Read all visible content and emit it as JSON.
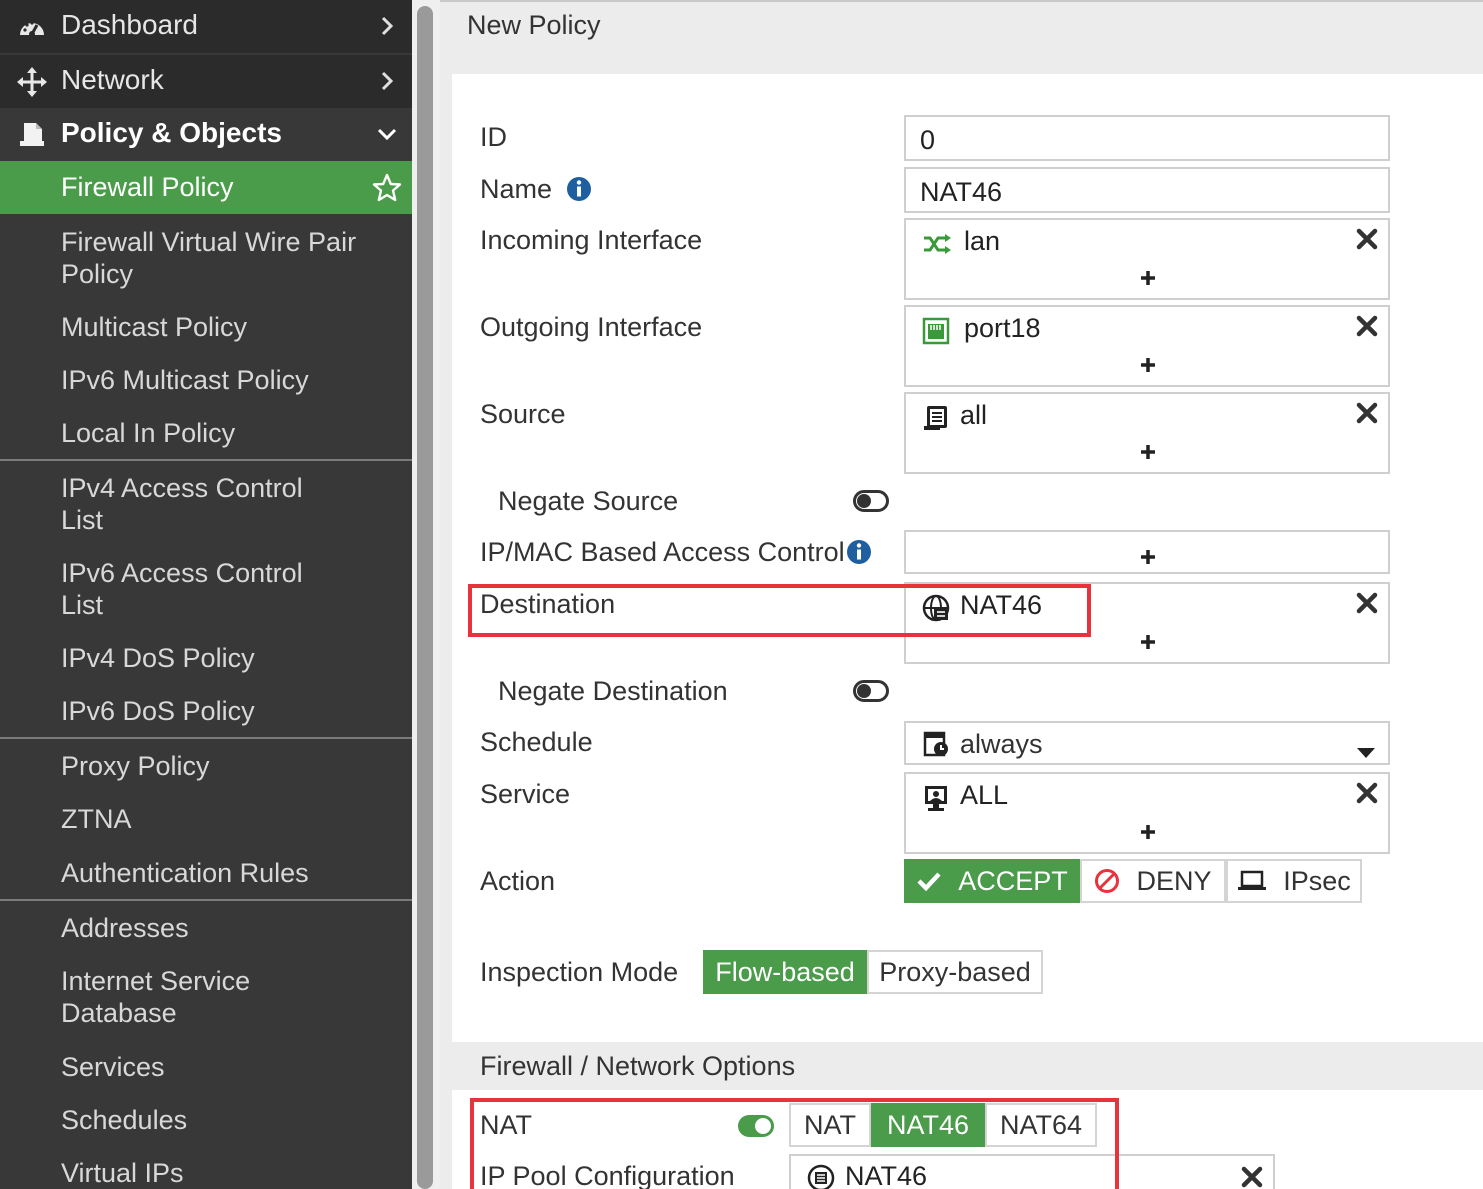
{
  "sidebar": {
    "top_items": [
      {
        "label": "Dashboard",
        "icon": "dashboard-icon"
      },
      {
        "label": "Network",
        "icon": "move-arrows-icon"
      },
      {
        "label": "Policy & Objects",
        "icon": "policy-document-icon"
      }
    ],
    "sub_items": [
      {
        "label": "Firewall Policy",
        "active": true
      },
      {
        "label": "Firewall Virtual Wire Pair Policy"
      },
      {
        "label": "Multicast Policy"
      },
      {
        "label": "IPv6 Multicast Policy"
      },
      {
        "label": "Local In Policy"
      },
      {
        "label": "IPv4 Access Control List"
      },
      {
        "label": "IPv6 Access Control List"
      },
      {
        "label": "IPv4 DoS Policy"
      },
      {
        "label": "IPv6 DoS Policy"
      },
      {
        "label": "Proxy Policy"
      },
      {
        "label": "ZTNA"
      },
      {
        "label": "Authentication Rules"
      },
      {
        "label": "Addresses"
      },
      {
        "label": "Internet Service Database"
      },
      {
        "label": "Services"
      },
      {
        "label": "Schedules"
      },
      {
        "label": "Virtual IPs"
      }
    ]
  },
  "page": {
    "title": "New Policy"
  },
  "form": {
    "id_label": "ID",
    "id_value": "0",
    "name_label": "Name",
    "name_value": "NAT46",
    "incoming_label": "Incoming Interface",
    "incoming_value": "lan",
    "outgoing_label": "Outgoing Interface",
    "outgoing_value": "port18",
    "source_label": "Source",
    "source_value": "all",
    "negate_source_label": "Negate Source",
    "ipmac_label": "IP/MAC Based Access Control",
    "destination_label": "Destination",
    "destination_value": "NAT46",
    "negate_destination_label": "Negate Destination",
    "schedule_label": "Schedule",
    "schedule_value": "always",
    "service_label": "Service",
    "service_value": "ALL",
    "action_label": "Action",
    "action_options": {
      "accept": "ACCEPT",
      "deny": "DENY",
      "ipsec": "IPsec"
    },
    "action_selected": "ACCEPT",
    "inspection_label": "Inspection Mode",
    "inspection_options": {
      "flow": "Flow-based",
      "proxy": "Proxy-based"
    },
    "inspection_selected": "Flow-based"
  },
  "firewall_options": {
    "section_title": "Firewall / Network Options",
    "nat_label": "NAT",
    "nat_enabled": true,
    "nat_modes": {
      "nat": "NAT",
      "nat46": "NAT46",
      "nat64": "NAT64"
    },
    "nat_mode_selected": "NAT46",
    "ip_pool_label": "IP Pool Configuration",
    "ip_pool_value": "NAT46"
  },
  "colors": {
    "accent_green": "#4a9b4a",
    "highlight_red": "#e8323c",
    "sidebar_bg": "#383838"
  }
}
